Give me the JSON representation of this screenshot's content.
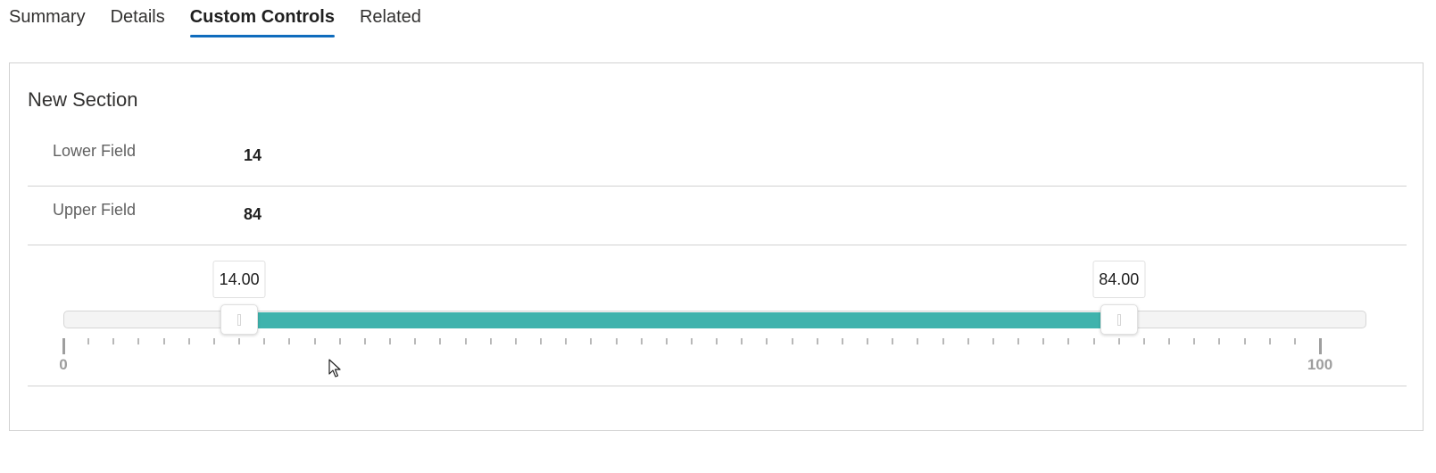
{
  "tabs": [
    {
      "label": "Summary",
      "active": false
    },
    {
      "label": "Details",
      "active": false
    },
    {
      "label": "Custom Controls",
      "active": true
    },
    {
      "label": "Related",
      "active": false
    }
  ],
  "section": {
    "title": "New Section",
    "fields": [
      {
        "label": "Lower Field",
        "value": "14"
      },
      {
        "label": "Upper Field",
        "value": "84"
      }
    ]
  },
  "range_slider": {
    "min": 0,
    "max": 100,
    "lower": 14,
    "upper": 84,
    "lower_display": "14.00",
    "upper_display": "84.00",
    "min_label": "0",
    "max_label": "100",
    "tick_count": 51,
    "fill_color": "#3fb3ad"
  },
  "colors": {
    "accent": "#0f6cbd",
    "range_fill": "#3fb3ad"
  },
  "icons": {
    "cursor": "mouse-pointer-icon"
  }
}
